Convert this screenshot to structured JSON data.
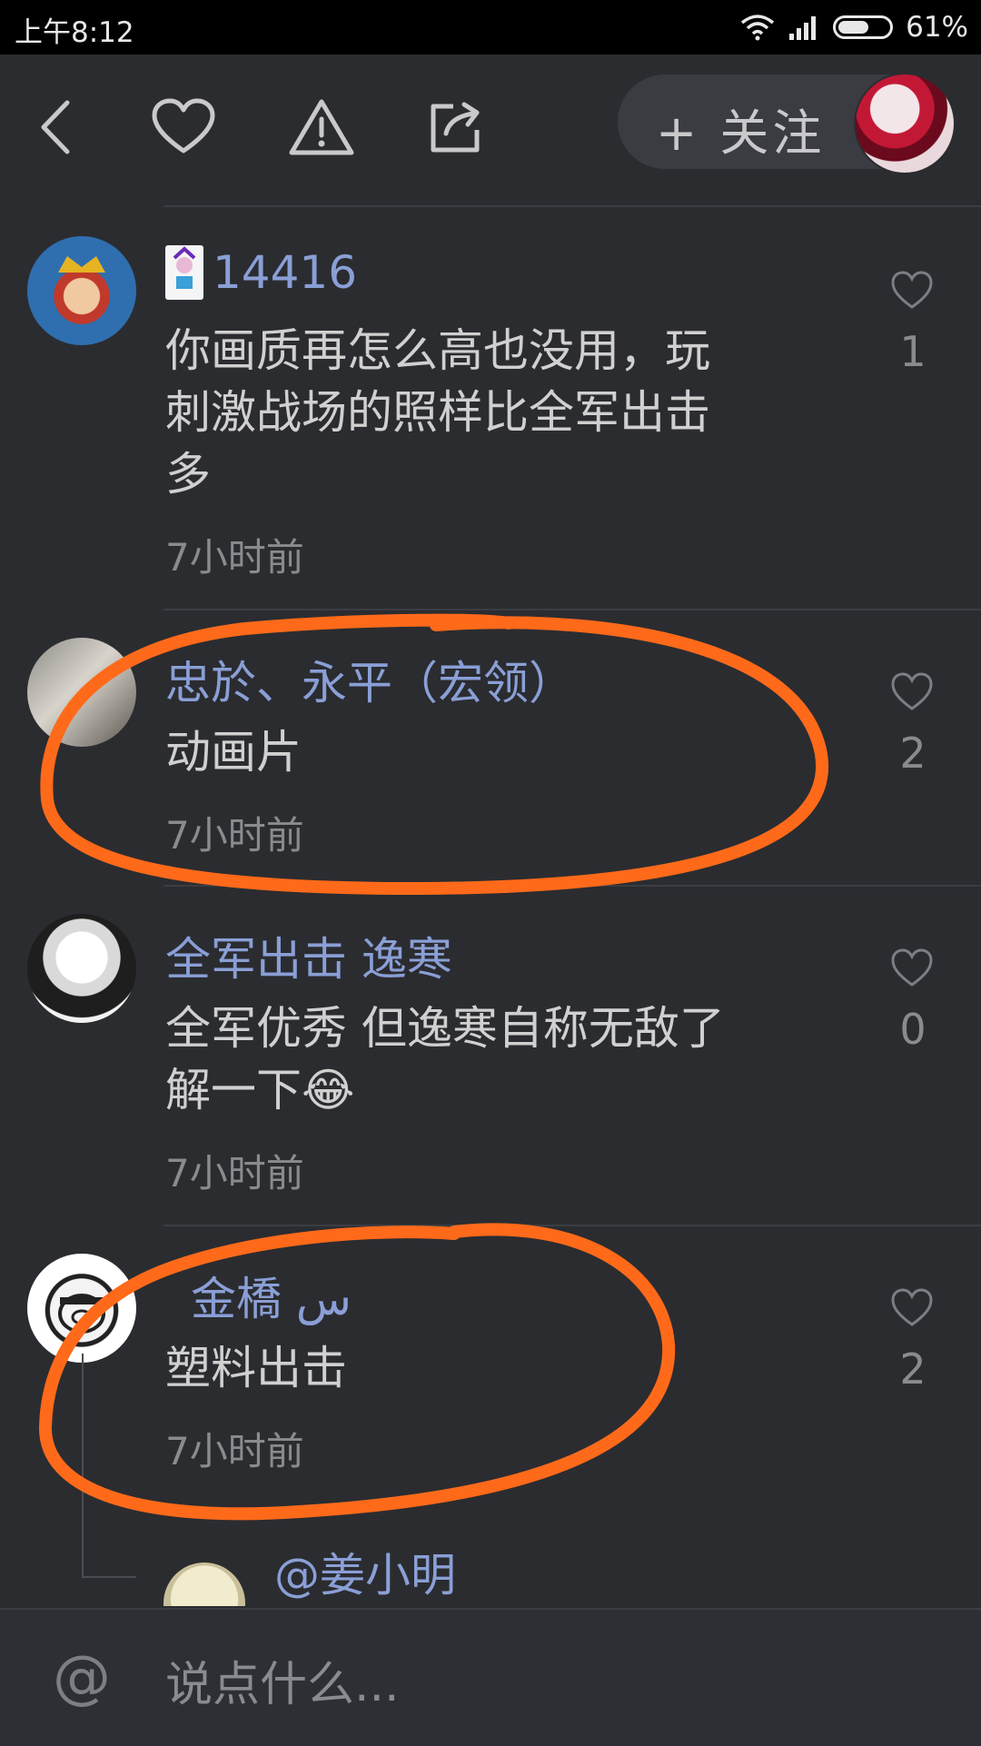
{
  "status_bar": {
    "time": "上午8:12",
    "battery_percent": "61%",
    "battery_level": 0.61
  },
  "header": {
    "back_icon": "chevron-left-icon",
    "like_icon": "heart-outline-icon",
    "report_icon": "warning-triangle-icon",
    "share_icon": "share-icon",
    "follow_label": "+ 关注"
  },
  "comments": [
    {
      "author": "14416",
      "content_lines": [
        "你画质再怎么高也没用，玩",
        "刺激战场的照样比全军出击",
        "多"
      ],
      "time": "7小时前",
      "likes": "1"
    },
    {
      "author": "忠於、永平（宏领）",
      "content_lines": [
        "动画片"
      ],
      "time": "7小时前",
      "likes": "2"
    },
    {
      "author": "全军出击 逸寒",
      "content_lines": [
        "全军优秀  但逸寒自称无敌了",
        "解一下"
      ],
      "emoji": "😂",
      "time": "7小时前",
      "likes": "0"
    },
    {
      "author": "金橋 س",
      "content_lines": [
        "塑料出击"
      ],
      "time": "7小时前",
      "likes": "2"
    }
  ],
  "reply_preview": {
    "author": "@姜小明"
  },
  "input": {
    "placeholder": "说点什么..."
  },
  "annotation": {
    "color": "#ff6a1a"
  }
}
